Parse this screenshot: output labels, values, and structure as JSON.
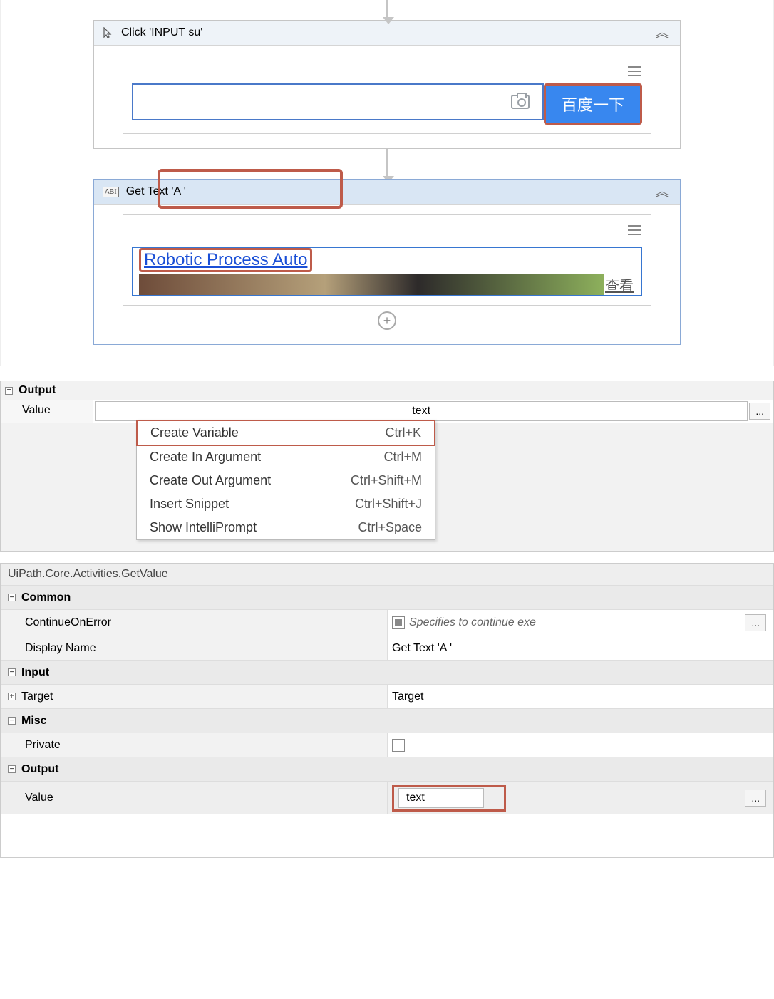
{
  "designer": {
    "activity1": {
      "title": "Click 'INPUT  su'",
      "button_text": "百度一下"
    },
    "activity2": {
      "title": "Get Text 'A '",
      "link_text": "Robotic Process Auto",
      "cn_label": "查看"
    }
  },
  "output_mini": {
    "group": "Output",
    "label": "Value",
    "value": "text",
    "menu": [
      {
        "label": "Create Variable",
        "shortcut": "Ctrl+K"
      },
      {
        "label": "Create In Argument",
        "shortcut": "Ctrl+M"
      },
      {
        "label": "Create Out Argument",
        "shortcut": "Ctrl+Shift+M"
      },
      {
        "label": "Insert Snippet",
        "shortcut": "Ctrl+Shift+J"
      },
      {
        "label": "Show IntelliPrompt",
        "shortcut": "Ctrl+Space"
      }
    ]
  },
  "props": {
    "class": "UiPath.Core.Activities.GetValue",
    "groups": {
      "common": "Common",
      "input": "Input",
      "misc": "Misc",
      "output": "Output"
    },
    "continue_on_error": {
      "label": "ContinueOnError",
      "hint": "Specifies to continue exe"
    },
    "display_name": {
      "label": "Display Name",
      "value": "Get Text 'A '"
    },
    "target": {
      "label": "Target",
      "value": "Target"
    },
    "private": {
      "label": "Private"
    },
    "output_value": {
      "label": "Value",
      "value": "text"
    },
    "ellipsis": "..."
  }
}
